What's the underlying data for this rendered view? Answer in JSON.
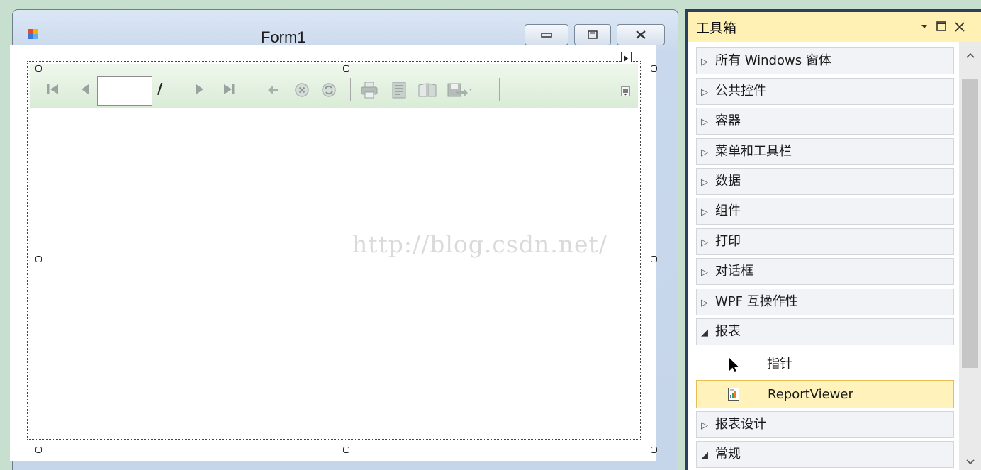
{
  "form": {
    "title": "Form1",
    "caption_buttons": [
      "minimize",
      "maximize",
      "close"
    ]
  },
  "report_viewer": {
    "page_slash": "/",
    "page_number": "",
    "icons": [
      "first-page-icon",
      "previous-page-icon",
      "next-page-icon",
      "last-page-icon",
      "back-icon",
      "stop-icon",
      "refresh-icon",
      "print-icon",
      "print-layout-icon",
      "page-setup-icon",
      "export-icon"
    ]
  },
  "watermark": "http://blog.csdn.net/",
  "toolbox": {
    "title": "工具箱",
    "groups": [
      {
        "label": "所有 Windows 窗体",
        "expanded": false
      },
      {
        "label": "公共控件",
        "expanded": false
      },
      {
        "label": "容器",
        "expanded": false
      },
      {
        "label": "菜单和工具栏",
        "expanded": false
      },
      {
        "label": "数据",
        "expanded": false
      },
      {
        "label": "组件",
        "expanded": false
      },
      {
        "label": "打印",
        "expanded": false
      },
      {
        "label": "对话框",
        "expanded": false
      },
      {
        "label": "WPF 互操作性",
        "expanded": false
      },
      {
        "label": "报表",
        "expanded": true
      },
      {
        "label": "报表设计",
        "expanded": false
      },
      {
        "label": "常规",
        "expanded": true
      }
    ],
    "report_items": [
      {
        "label": "指针",
        "icon": "pointer-icon",
        "selected": false
      },
      {
        "label": "ReportViewer",
        "icon": "reportviewer-icon",
        "selected": true
      }
    ]
  },
  "colors": {
    "toolbox_header": "#fff0b3",
    "selection": "#fff2ba",
    "toolbox_border": "#2d3f5f"
  }
}
